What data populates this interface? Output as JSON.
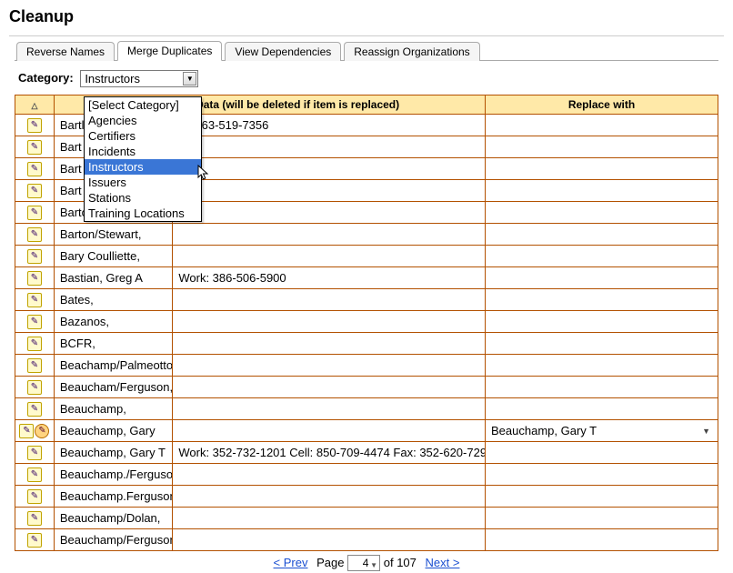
{
  "page_title": "Cleanup",
  "tabs": [
    {
      "label": "Reverse Names",
      "active": false
    },
    {
      "label": "Merge Duplicates",
      "active": true
    },
    {
      "label": "View Dependencies",
      "active": false
    },
    {
      "label": "Reassign Organizations",
      "active": false
    }
  ],
  "category": {
    "label": "Category:",
    "selected": "Instructors",
    "options": [
      "[Select Category]",
      "Agencies",
      "Certifiers",
      "Incidents",
      "Instructors",
      "Issuers",
      "Stations",
      "Training Locations"
    ],
    "highlighted_index": 4
  },
  "columns": {
    "edit": "",
    "ref": "Reference Data (will be deleted if item is replaced)",
    "replace": "Replace with"
  },
  "rows": [
    {
      "name": "Bartl",
      "contact": "rk: 863-519-7356",
      "replace": "",
      "annot": false,
      "obscured": true
    },
    {
      "name": "Bart",
      "contact": "",
      "replace": "",
      "annot": false,
      "obscured": true
    },
    {
      "name": "Bart",
      "contact": "",
      "replace": "",
      "annot": false,
      "obscured": true
    },
    {
      "name": "Bart",
      "contact": "",
      "replace": "",
      "annot": false,
      "obscured": true
    },
    {
      "name": "Barton/Pogier,",
      "contact": "",
      "replace": "",
      "annot": false
    },
    {
      "name": "Barton/Stewart,",
      "contact": "",
      "replace": "",
      "annot": false
    },
    {
      "name": "Bary Coulliette,",
      "contact": "",
      "replace": "",
      "annot": false
    },
    {
      "name": "Bastian, Greg A",
      "contact": "Work: 386-506-5900",
      "replace": "",
      "annot": false
    },
    {
      "name": "Bates,",
      "contact": "",
      "replace": "",
      "annot": false
    },
    {
      "name": "Bazanos,",
      "contact": "",
      "replace": "",
      "annot": false
    },
    {
      "name": "BCFR,",
      "contact": "",
      "replace": "",
      "annot": false
    },
    {
      "name": "Beachamp/Palmeotto,",
      "contact": "",
      "replace": "",
      "annot": false
    },
    {
      "name": "Beaucham/Ferguson,",
      "contact": "",
      "replace": "",
      "annot": false
    },
    {
      "name": "Beauchamp,",
      "contact": "",
      "replace": "",
      "annot": false
    },
    {
      "name": "Beauchamp, Gary",
      "contact": "",
      "replace": "Beauchamp, Gary T",
      "annot": true
    },
    {
      "name": "Beauchamp, Gary T",
      "contact": "Work: 352-732-1201 Cell: 850-709-4474 Fax: 352-620-7293",
      "replace": "",
      "annot": false
    },
    {
      "name": "Beauchamp./Ferguson,",
      "contact": "",
      "replace": "",
      "annot": false
    },
    {
      "name": "Beauchamp.Ferguson,",
      "contact": "",
      "replace": "",
      "annot": false
    },
    {
      "name": "Beauchamp/Dolan,",
      "contact": "",
      "replace": "",
      "annot": false
    },
    {
      "name": "Beauchamp/Ferguson,",
      "contact": "",
      "replace": "",
      "annot": false
    }
  ],
  "pager": {
    "prev": "< Prev",
    "page_label": "Page",
    "current": "4",
    "of_label": "of",
    "total": "107",
    "next": "Next >"
  }
}
